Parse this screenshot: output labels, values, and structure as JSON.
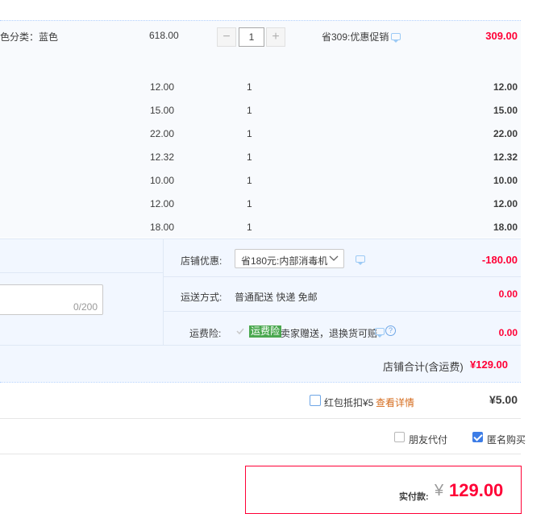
{
  "order": {
    "item": {
      "variant": "色分类：蓝色",
      "unit_price": "618.00",
      "quantity": "1",
      "minus": "−",
      "plus": "+",
      "promo": "省309:优惠促销",
      "subtotal": "309.00"
    },
    "addons": [
      {
        "price": "12.00",
        "qty": "1",
        "total": "12.00"
      },
      {
        "price": "15.00",
        "qty": "1",
        "total": "15.00"
      },
      {
        "price": "22.00",
        "qty": "1",
        "total": "22.00"
      },
      {
        "price": "12.32",
        "qty": "1",
        "total": "12.32"
      },
      {
        "price": "10.00",
        "qty": "1",
        "total": "10.00"
      },
      {
        "price": "12.00",
        "qty": "1",
        "total": "12.00"
      },
      {
        "price": "18.00",
        "qty": "1",
        "total": "18.00"
      }
    ]
  },
  "shop": {
    "discount_label": "店铺优惠:",
    "discount_select": "省180元:内部消毒机",
    "discount_value": "-180.00",
    "message_counter": "0/200",
    "shipping_label": "运送方式:",
    "shipping_text": "普通配送 快递 免邮",
    "shipping_value": "0.00",
    "insurance_label": "运费险:",
    "insurance_tag": "运费险",
    "insurance_text": "卖家赠送，退换货可赔",
    "insurance_value": "0.00",
    "total_label": "店铺合计(含运费)",
    "total_value": "¥129.00"
  },
  "redpacket": {
    "label": "红包抵扣¥5",
    "link": "查看详情",
    "value": "¥5.00"
  },
  "options": {
    "friend_pay": "朋友代付",
    "anonymous": "匿名购买"
  },
  "payment": {
    "label": "实付款:",
    "currency": "¥",
    "amount": "129.00"
  },
  "colors": {
    "accent_red": "#ff0036",
    "link_orange": "#d56b1c",
    "tag_green": "#4aa84f",
    "checkbox_blue": "#3d7de6",
    "panel_bg": "#f8fafd"
  },
  "icons": [
    "chat-icon",
    "help-icon",
    "chevron-down-icon",
    "checkmark-icon"
  ]
}
